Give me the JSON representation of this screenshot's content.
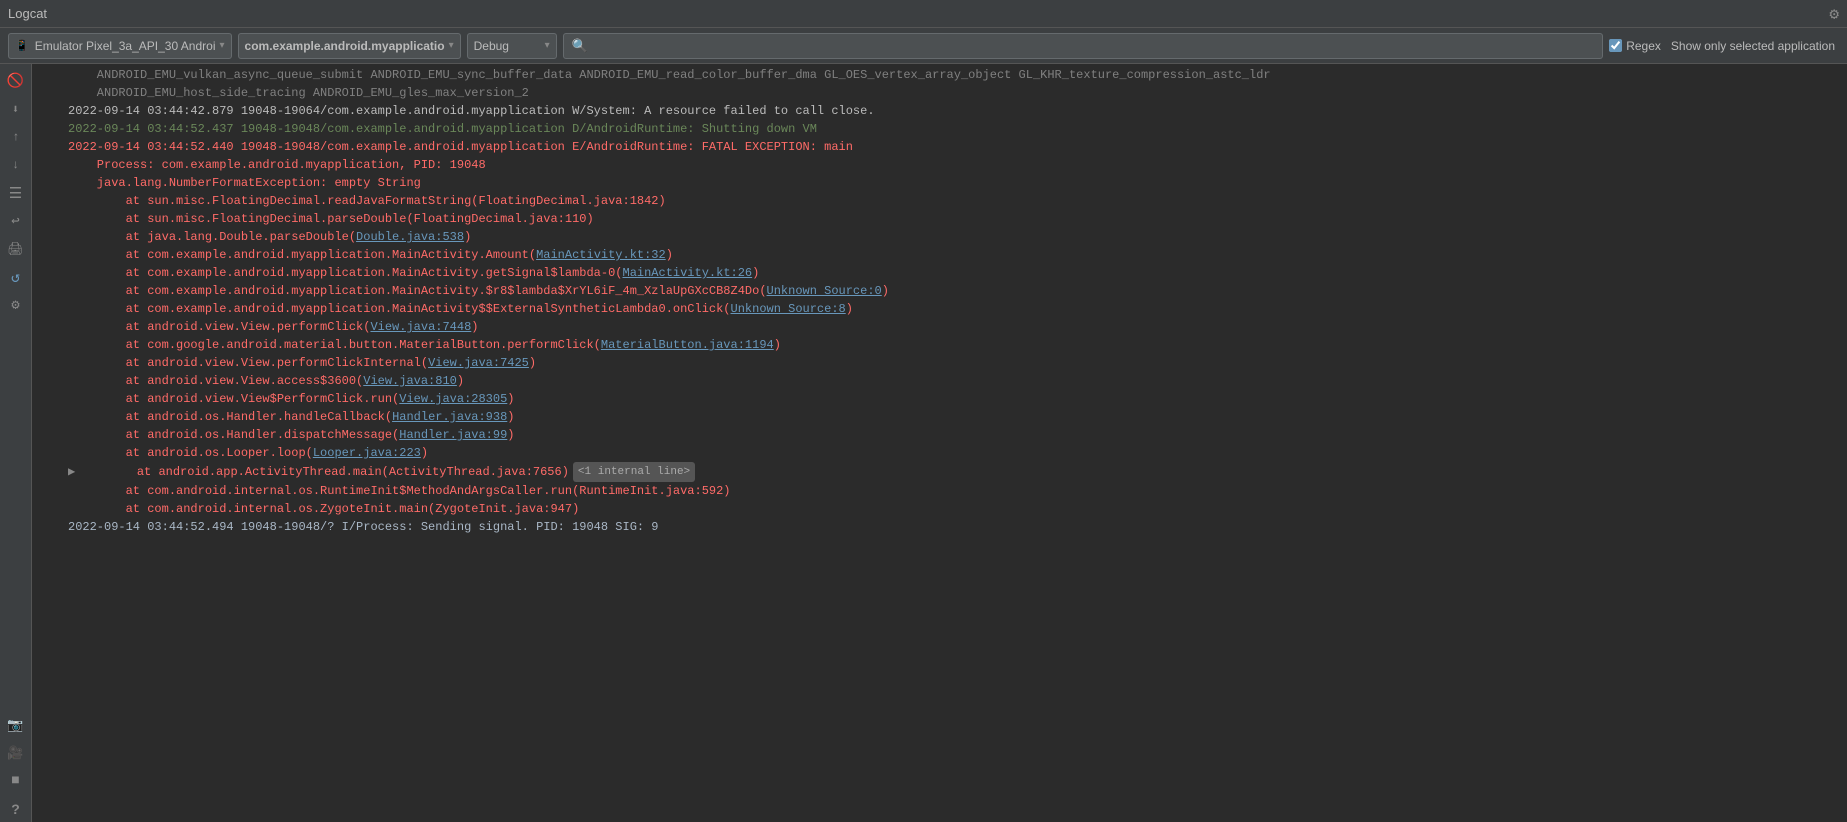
{
  "titleBar": {
    "title": "Logcat",
    "settingsIcon": "⚙"
  },
  "toolbar": {
    "emulatorLabel": "Emulator Pixel_3a_API_30 Androi",
    "packageLabel": "com.example.android.myapplicatio",
    "levelLabel": "Debug",
    "searchPlaceholder": "",
    "regexLabel": "Regex",
    "showOnlyLabel": "Show only selected application",
    "regexChecked": true
  },
  "sidebarIcons": [
    {
      "name": "clear-icon",
      "glyph": "🚫",
      "label": "Clear"
    },
    {
      "name": "scroll-end-icon",
      "glyph": "⬇",
      "label": "Scroll to end"
    },
    {
      "name": "scroll-up-icon",
      "glyph": "⬆",
      "label": "Scroll up"
    },
    {
      "name": "scroll-down-icon",
      "glyph": "⬇",
      "label": "Scroll down"
    },
    {
      "name": "filter-icon",
      "glyph": "≡",
      "label": "Filter"
    },
    {
      "name": "soft-wrap-icon",
      "glyph": "↩",
      "label": "Soft wrap"
    },
    {
      "name": "print-icon",
      "glyph": "🖨",
      "label": "Print"
    },
    {
      "name": "reload-icon",
      "glyph": "↺",
      "label": "Reload"
    },
    {
      "name": "settings-icon",
      "glyph": "⚙",
      "label": "Settings"
    },
    {
      "name": "camera-icon",
      "glyph": "📷",
      "label": "Screenshot"
    },
    {
      "name": "video-icon",
      "glyph": "🎥",
      "label": "Screen record"
    },
    {
      "name": "stop-icon",
      "glyph": "■",
      "label": "Stop"
    },
    {
      "name": "help-icon",
      "glyph": "?",
      "label": "Help"
    }
  ],
  "logLines": [
    {
      "type": "gray",
      "text": "    ANDROID_EMU_vulkan_async_queue_submit ANDROID_EMU_sync_buffer_data ANDROID_EMU_read_color_buffer_dma GL_OES_vertex_array_object GL_KHR_texture_compression_astc_ldr"
    },
    {
      "type": "gray",
      "text": "    ANDROID_EMU_host_side_tracing ANDROID_EMU_gles_max_version_2"
    },
    {
      "type": "warn",
      "text": "2022-09-14 03:44:42.879 19048-19064/com.example.android.myapplication W/System: A resource failed to call close."
    },
    {
      "type": "debug",
      "text": "2022-09-14 03:44:52.437 19048-19048/com.example.android.myapplication D/AndroidRuntime: Shutting down VM"
    },
    {
      "type": "error",
      "text": "2022-09-14 03:44:52.440 19048-19048/com.example.android.myapplication E/AndroidRuntime: FATAL EXCEPTION: main"
    },
    {
      "type": "error-detail",
      "text": "    Process: com.example.android.myapplication, PID: 19048"
    },
    {
      "type": "error-detail",
      "text": "    java.lang.NumberFormatException: empty String"
    },
    {
      "type": "error-detail",
      "text": "    \tat sun.misc.FloatingDecimal.readJavaFormatString(FloatingDecimal.java:1842)"
    },
    {
      "type": "error-detail",
      "text": "    \tat sun.misc.FloatingDecimal.parseDouble(FloatingDecimal.java:110)"
    },
    {
      "type": "error-detail",
      "text": "    \tat java.lang.Double.parseDouble(Double.java:538)",
      "link": "Double.java:538"
    },
    {
      "type": "error-detail",
      "text": "    \tat com.example.android.myapplication.MainActivity.Amount(",
      "link": "MainActivity.kt:32",
      "afterLink": ")"
    },
    {
      "type": "error-detail",
      "text": "    \tat com.example.android.myapplication.MainActivity.getSignal$lambda-0(",
      "link": "MainActivity.kt:26",
      "afterLink": ")"
    },
    {
      "type": "error-detail",
      "text": "    \tat com.example.android.myapplication.MainActivity.$r8$lambda$XrYL6iF_4m_XzlaUpGXcCB8Z4Do(",
      "link": "Unknown Source:0",
      "afterLink": ")"
    },
    {
      "type": "error-detail",
      "text": "    \tat com.example.android.myapplication.MainActivity$$ExternalSyntheticLambda0.onClick(",
      "link": "Unknown Source:8",
      "afterLink": ")"
    },
    {
      "type": "error-detail",
      "text": "    \tat android.view.View.performClick(",
      "link": "View.java:7448",
      "afterLink": ")"
    },
    {
      "type": "error-detail",
      "text": "    \tat com.google.android.material.button.MaterialButton.performClick(",
      "link": "MaterialButton.java:1194",
      "afterLink": ")"
    },
    {
      "type": "error-detail",
      "text": "    \tat android.view.View.performClickInternal(",
      "link": "View.java:7425",
      "afterLink": ")"
    },
    {
      "type": "error-detail",
      "text": "    \tat android.view.View.access$3600(",
      "link": "View.java:810",
      "afterLink": ")"
    },
    {
      "type": "error-detail",
      "text": "    \tat android.view.View$PerformClick.run(",
      "link": "View.java:28305",
      "afterLink": ")"
    },
    {
      "type": "error-detail",
      "text": "    \tat android.os.Handler.handleCallback(",
      "link": "Handler.java:938",
      "afterLink": ")"
    },
    {
      "type": "error-detail",
      "text": "    \tat android.os.Handler.dispatchMessage(",
      "link": "Handler.java:99",
      "afterLink": ")"
    },
    {
      "type": "error-detail",
      "text": "    \tat android.os.Looper.loop(",
      "link": "Looper.java:223",
      "afterLink": ")"
    },
    {
      "type": "error-detail-badge",
      "text": "    \tat android.app.ActivityThread.main(ActivityThread.java:7656)",
      "badge": "<1 internal line>"
    },
    {
      "type": "error-detail",
      "text": "    \tat com.android.internal.os.RuntimeInit$MethodAndArgsCaller.run(RuntimeInit.java:592)"
    },
    {
      "type": "error-detail",
      "text": "    \tat com.android.internal.os.ZygoteInit.main(ZygoteInit.java:947)"
    },
    {
      "type": "info",
      "text": "2022-09-14 03:44:52.494 19048-19048/? I/Process: Sending signal. PID: 19048 SIG: 9"
    }
  ],
  "bottomBar": {
    "expandIcon": "▶",
    "logText": "    at android.app.ActivityThread.main(ActivityThread.java:7656)"
  }
}
